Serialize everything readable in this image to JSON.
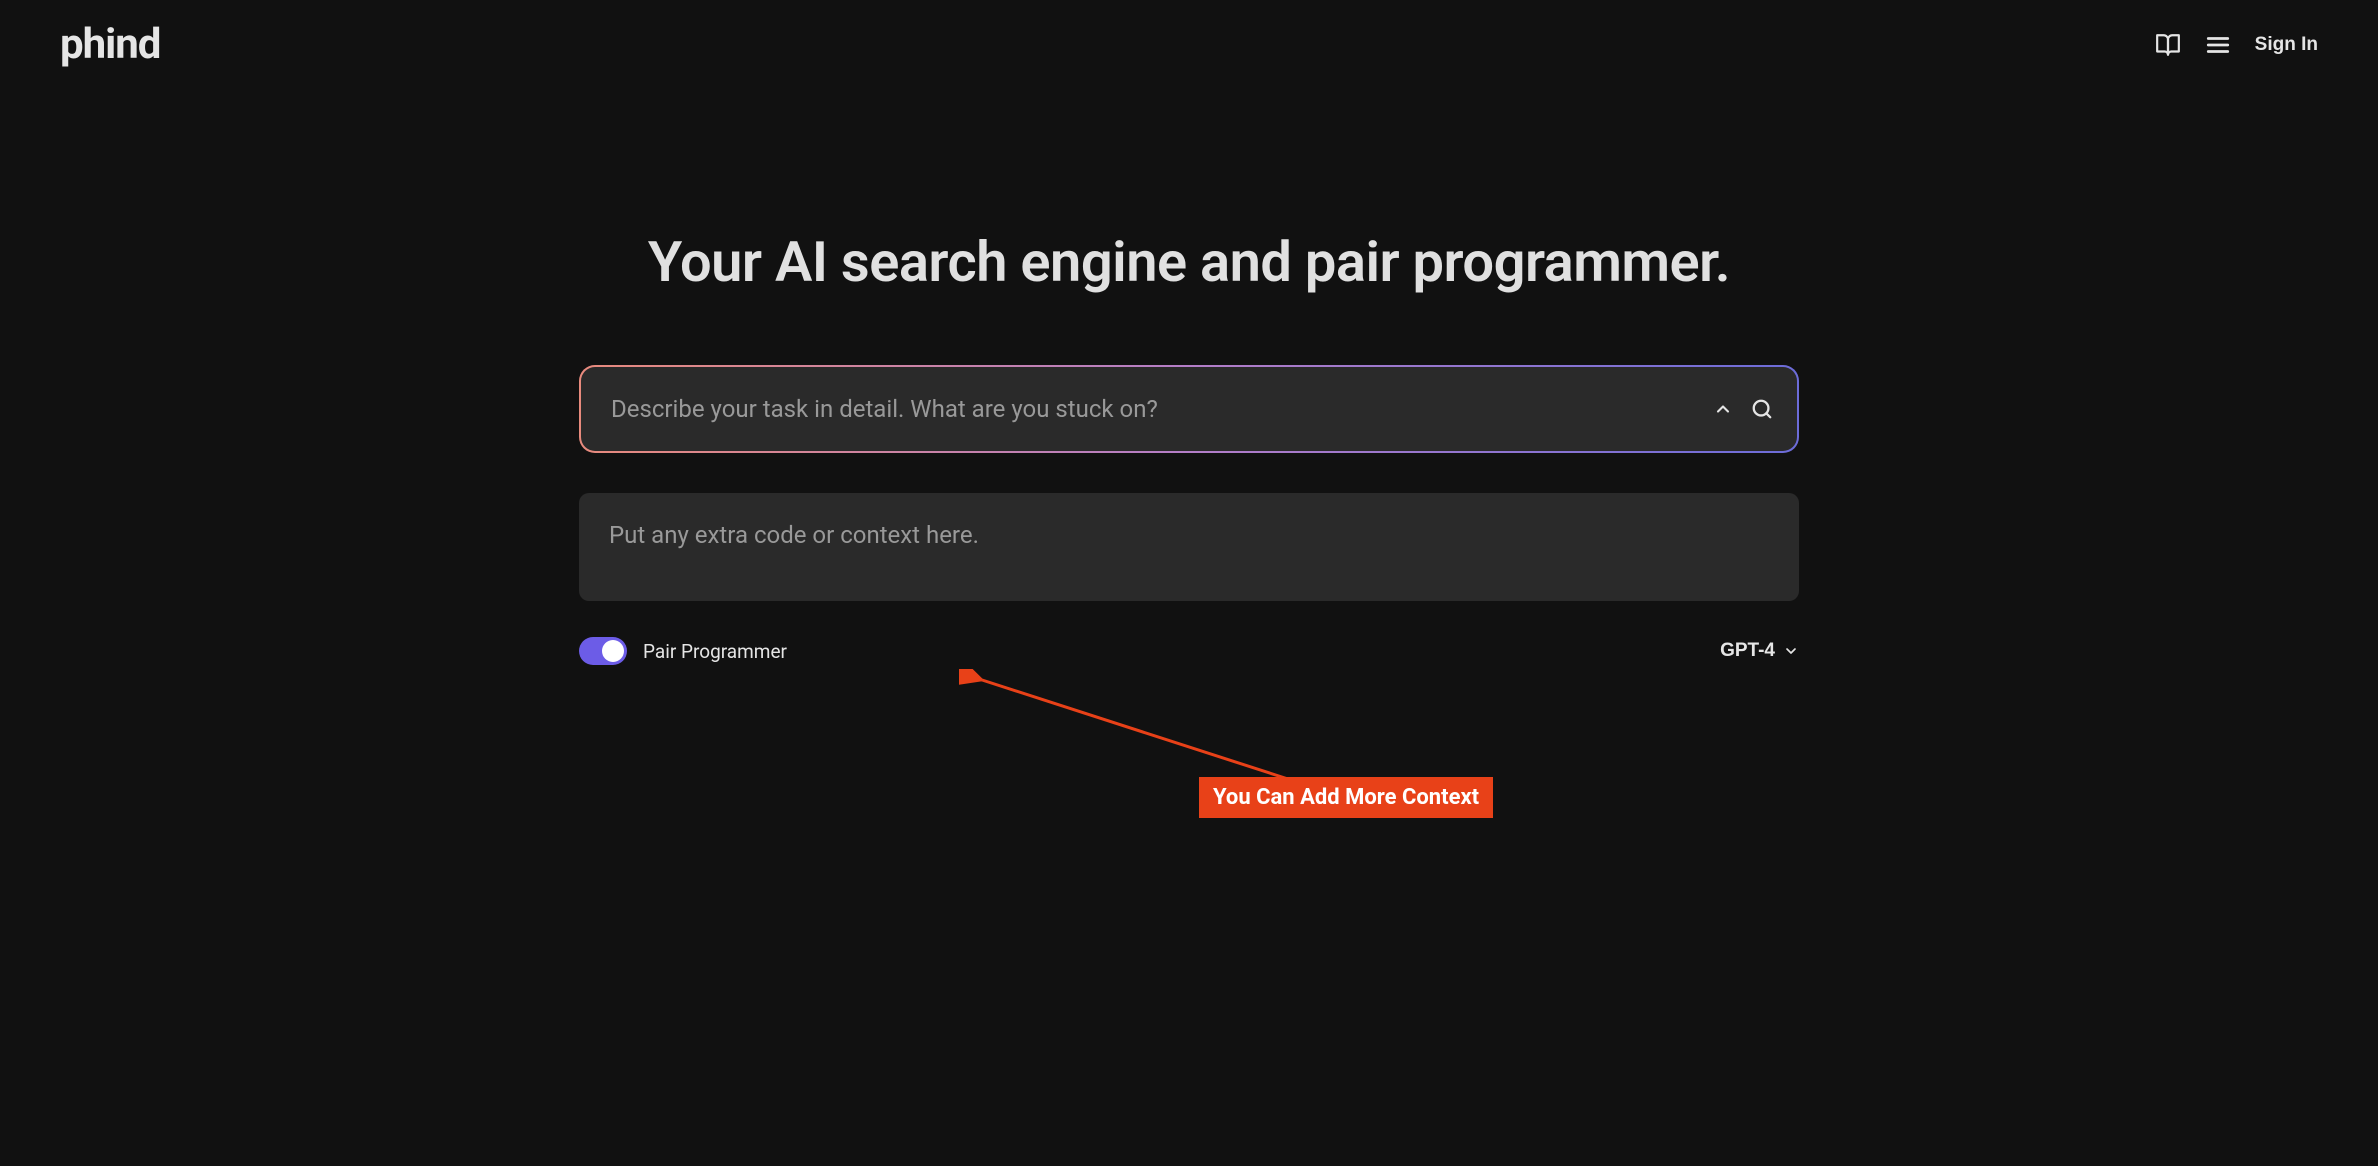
{
  "header": {
    "logo": "phind",
    "signin": "Sign In"
  },
  "hero": {
    "title": "Your AI search engine and pair programmer."
  },
  "search": {
    "placeholder": "Describe your task in detail. What are you stuck on?",
    "value": ""
  },
  "context": {
    "placeholder": "Put any extra code or context here.",
    "value": ""
  },
  "toggle": {
    "label": "Pair Programmer",
    "enabled": true
  },
  "model": {
    "label": "GPT-4"
  },
  "annotation": {
    "text": "You Can Add More Context"
  }
}
